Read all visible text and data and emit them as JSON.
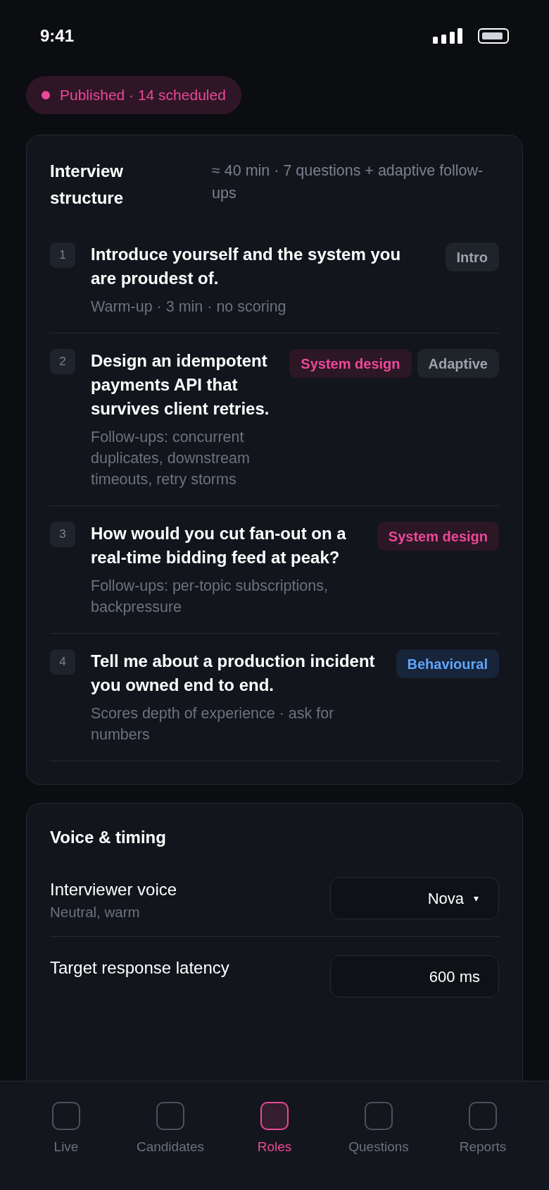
{
  "status_bar": {
    "time": "9:41"
  },
  "status_badge": {
    "label": "Published · 14 scheduled",
    "color": "#ec4899"
  },
  "structure": {
    "title": "Interview structure",
    "summary": "≈ 40 min · 7 questions + adaptive follow-ups",
    "questions": [
      {
        "number": "1",
        "text": "Introduce yourself and the system you are proudest of.",
        "meta": "Warm-up · 3 min · no scoring",
        "tags": [
          {
            "label": "Intro",
            "kind": "neutral"
          }
        ]
      },
      {
        "number": "2",
        "text": "Design an idempotent payments API that survives client retries.",
        "meta": "Follow-ups: concurrent duplicates, downstream timeouts, retry storms",
        "tags": [
          {
            "label": "System design",
            "kind": "topic"
          },
          {
            "label": "Adaptive",
            "kind": "neutral"
          }
        ]
      },
      {
        "number": "3",
        "text": "How would you cut fan-out on a real-time bidding feed at peak?",
        "meta": "Follow-ups: per-topic subscriptions, backpressure",
        "tags": [
          {
            "label": "System design",
            "kind": "topic"
          }
        ]
      },
      {
        "number": "4",
        "text": "Tell me about a production incident you owned end to end.",
        "meta": "Scores depth of experience · ask for numbers",
        "tags": [
          {
            "label": "Behavioural",
            "kind": "behavioural"
          }
        ]
      }
    ]
  },
  "voice_timing": {
    "title": "Voice & timing",
    "settings": [
      {
        "kind": "select",
        "label": "Interviewer voice",
        "sublabel": "Neutral, warm",
        "value": "Nova",
        "caret": "▾"
      },
      {
        "kind": "input",
        "label": "Target response latency",
        "value": "600 ms"
      }
    ]
  },
  "tab_bar": [
    {
      "label": "Live",
      "selected": false
    },
    {
      "label": "Candidates",
      "selected": false
    },
    {
      "label": "Roles",
      "selected": true
    },
    {
      "label": "Questions",
      "selected": false
    },
    {
      "label": "Reports",
      "selected": false
    }
  ]
}
